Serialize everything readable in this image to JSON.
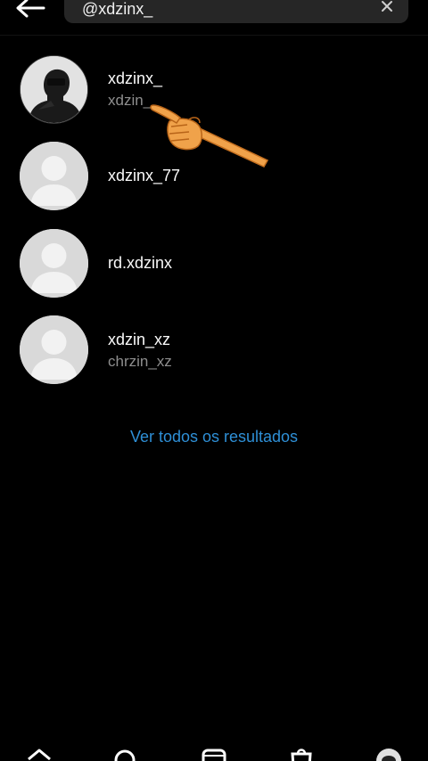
{
  "search": {
    "value": "@xdzinx_",
    "placeholder": ""
  },
  "results": [
    {
      "username": "xdzinx_",
      "fullname": "xdzin_"
    },
    {
      "username": "xdzinx_77",
      "fullname": ""
    },
    {
      "username": "rd.xdzinx",
      "fullname": ""
    },
    {
      "username": "xdzin_xz",
      "fullname": "chrzin_xz"
    }
  ],
  "see_all_label": "Ver todos os resultados",
  "colors": {
    "background": "#000000",
    "link": "#2e8fd6",
    "secondary_text": "#8e8e8e",
    "pointer_hand": "#f0a24a"
  },
  "icons": {
    "back": "arrow-left-icon",
    "clear": "close-icon",
    "nav": [
      "home-icon",
      "search-icon",
      "reels-icon",
      "shop-icon",
      "profile-avatar"
    ]
  }
}
